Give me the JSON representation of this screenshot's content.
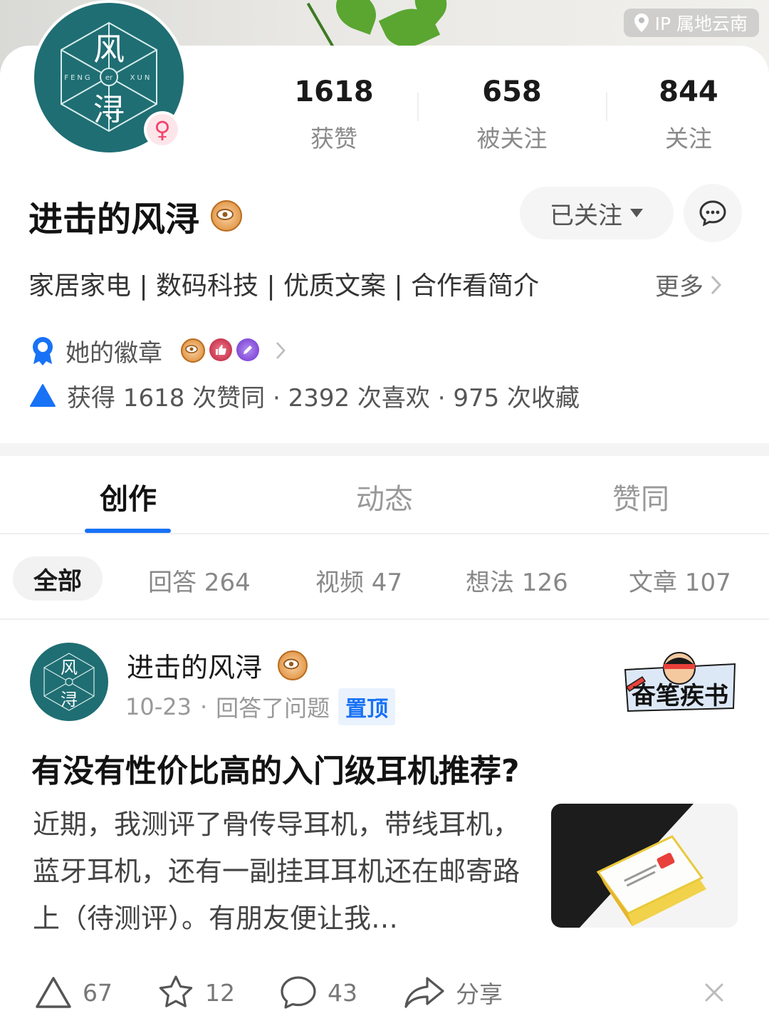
{
  "banner": {
    "ip_label": "IP 属地云南"
  },
  "profile": {
    "avatar_text_top": "风",
    "avatar_text_bottom": "浔",
    "avatar_text_left": "FENG",
    "avatar_text_mid": "er",
    "avatar_text_right": "XUN",
    "gender_symbol": "♀",
    "name": "进击的风浔",
    "stats": [
      {
        "value": "1618",
        "label": "获赞"
      },
      {
        "value": "658",
        "label": "被关注"
      },
      {
        "value": "844",
        "label": "关注"
      }
    ],
    "follow_label": "已关注",
    "tags": "家居家电 | 数码科技 | 优质文案 | 合作看简介",
    "more_label": "更多",
    "badge_label": "她的徽章",
    "likes_text": "获得 1618 次赞同 · 2392 次喜欢 · 975 次收藏"
  },
  "tabs": [
    {
      "label": "创作",
      "active": true
    },
    {
      "label": "动态",
      "active": false
    },
    {
      "label": "赞同",
      "active": false
    }
  ],
  "filters": [
    {
      "label": "全部",
      "active": true
    },
    {
      "label": "回答 264",
      "active": false
    },
    {
      "label": "视频 47",
      "active": false
    },
    {
      "label": "想法 126",
      "active": false
    },
    {
      "label": "文章 107",
      "active": false
    }
  ],
  "post": {
    "author": "进击的风浔",
    "date": "10-23",
    "dot": "·",
    "action": "回答了问题",
    "pin_label": "置顶",
    "sticker_text": "奋笔疾书",
    "question": "有没有性价比高的入门级耳机推荐?",
    "excerpt": "近期，我测评了骨传导耳机，带线耳机，蓝牙耳机，还有一副挂耳耳机还在邮寄路上（待测评）。有朋友便让我…",
    "actions": {
      "upvote": "67",
      "favorite": "12",
      "comment": "43",
      "share": "分享"
    }
  },
  "colors": {
    "accent": "#1772f6",
    "avatar_teal": "#1f6e73",
    "gender_pink": "#f4436c"
  }
}
